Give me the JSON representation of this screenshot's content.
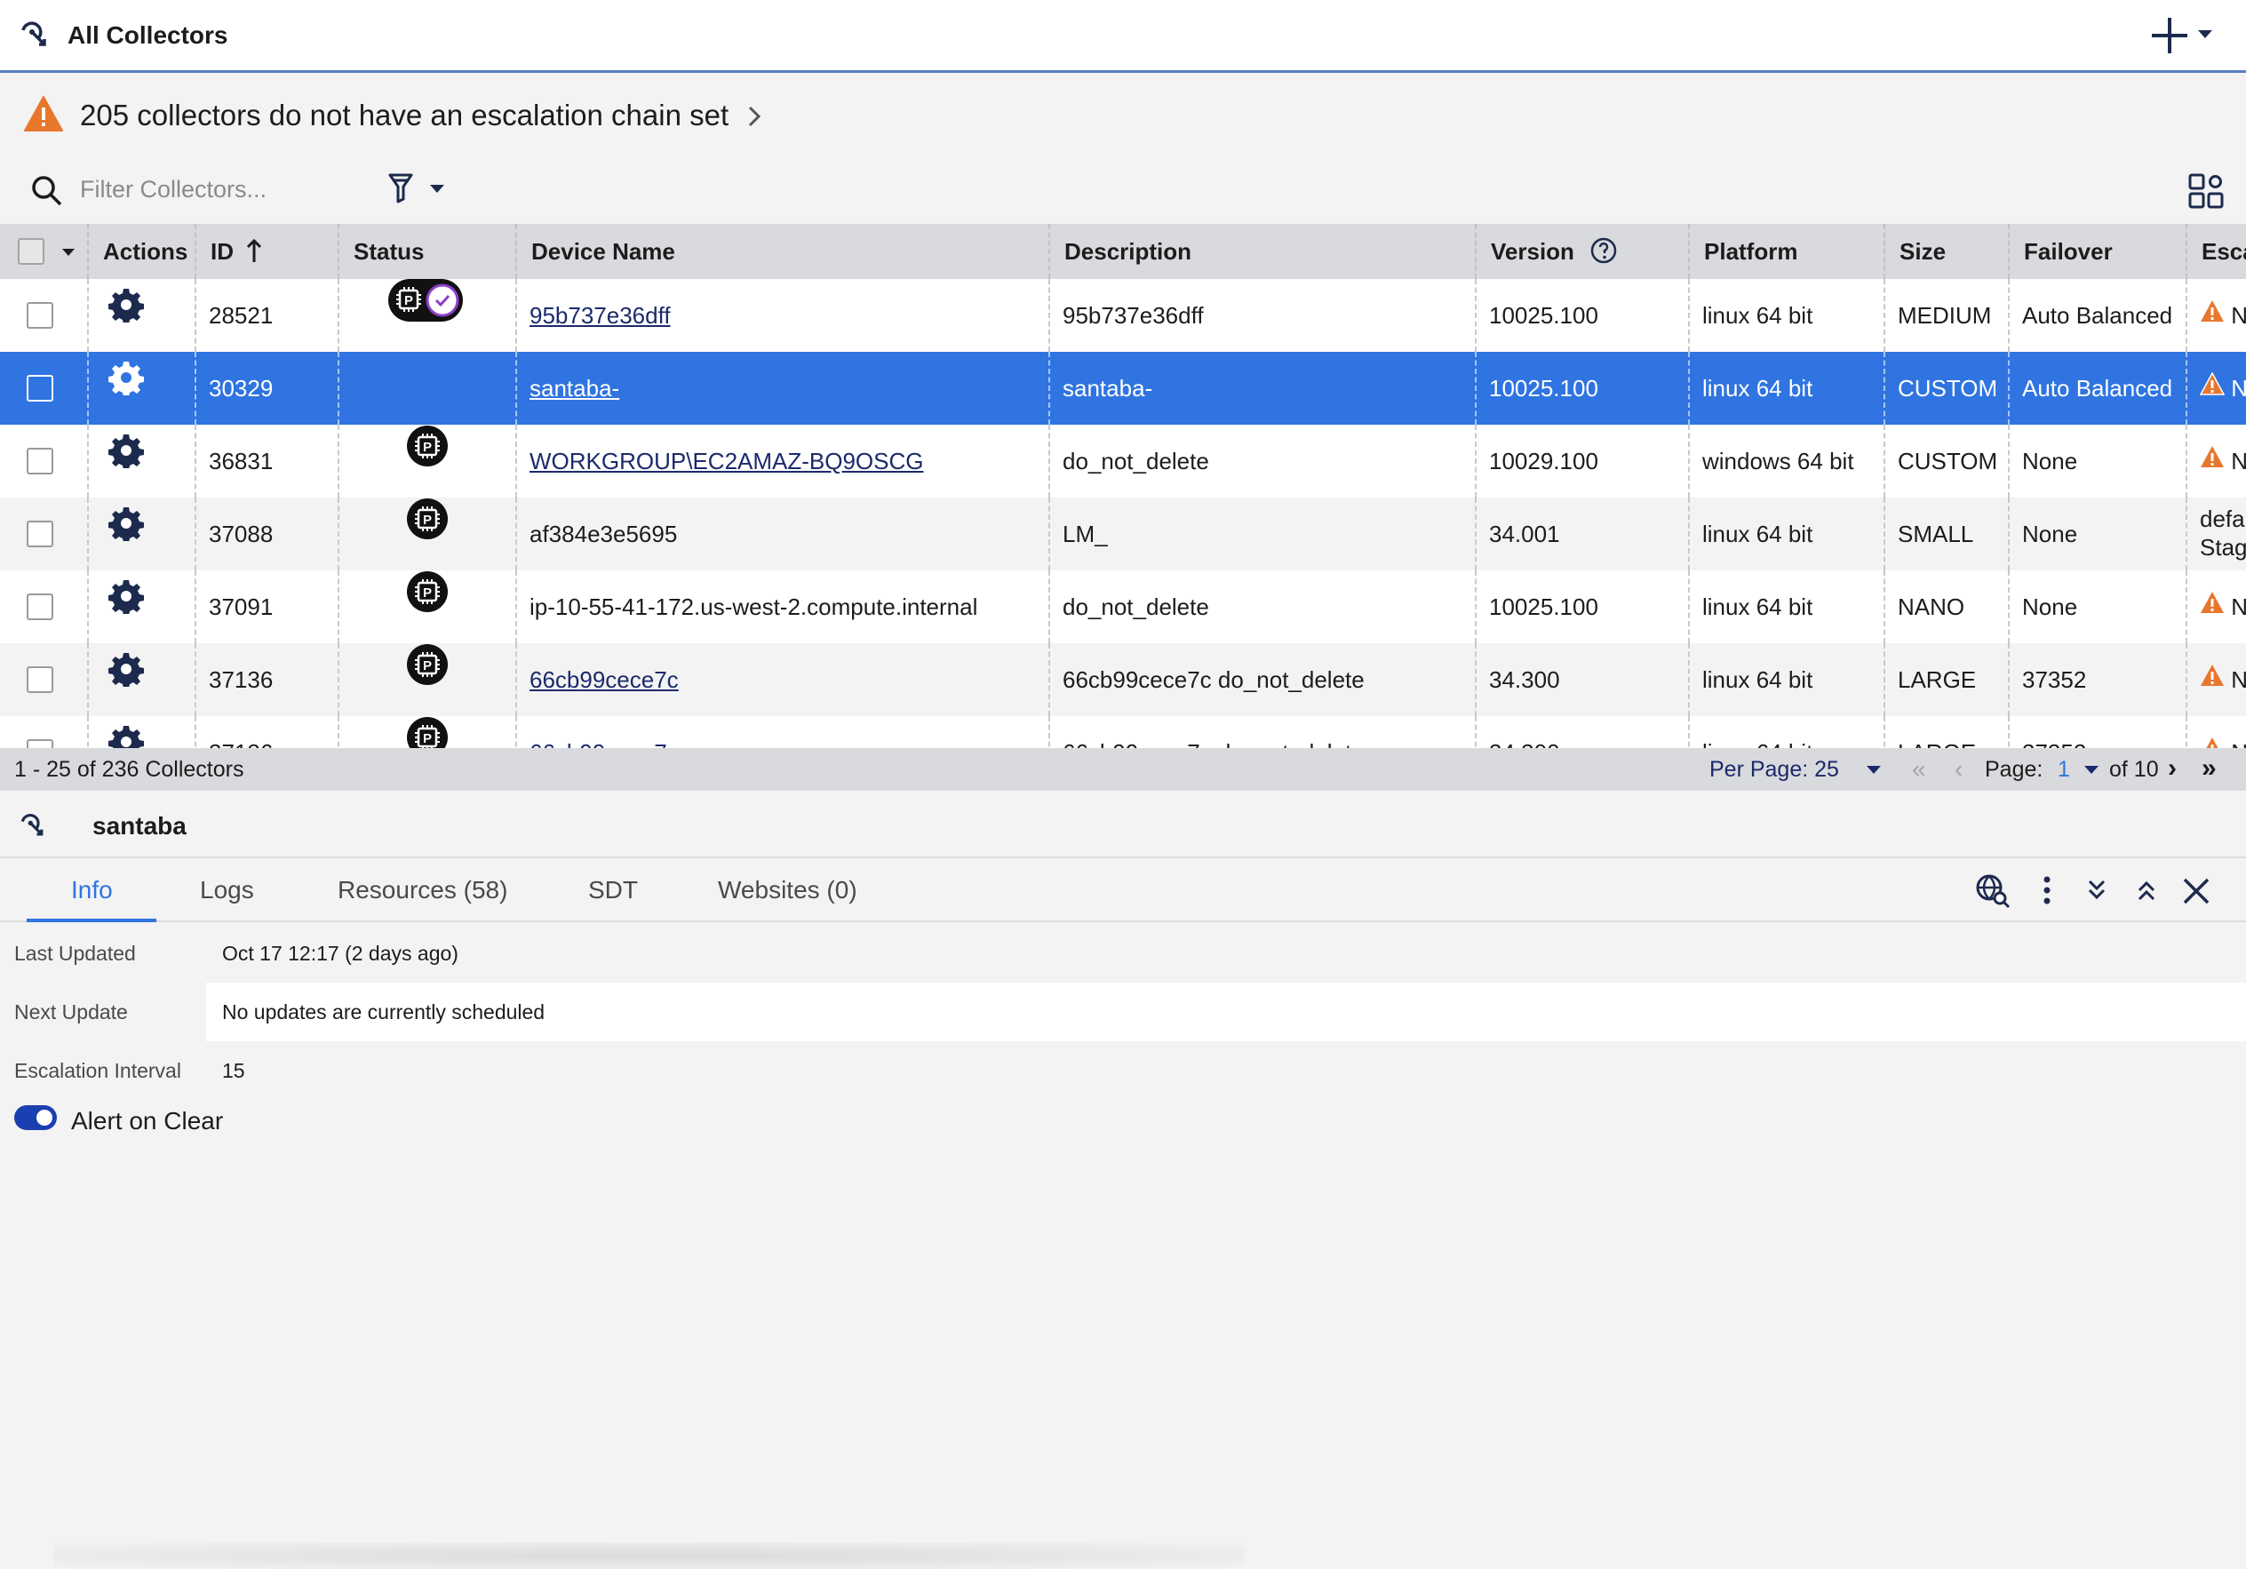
{
  "header": {
    "title": "All Collectors"
  },
  "warning": {
    "text": "205 collectors do not have an escalation chain set"
  },
  "filter": {
    "placeholder": "Filter Collectors..."
  },
  "table": {
    "columns": [
      "Actions",
      "ID",
      "Status",
      "Device Name",
      "Description",
      "Version",
      "Platform",
      "Size",
      "Failover",
      "Esca"
    ],
    "rows": [
      {
        "id": "28521",
        "status": "up-sdt",
        "device": "95b737e36dff",
        "device_link": true,
        "description": "95b737e36dff",
        "version": "10025.100",
        "platform": "linux 64 bit",
        "size": "MEDIUM",
        "failover": "Auto Balanced",
        "esc": "N",
        "esc_warn": true
      },
      {
        "id": "30329",
        "status": "",
        "device": "santaba-",
        "device_link": true,
        "description": "santaba-",
        "version": "10025.100",
        "platform": "linux 64 bit",
        "size": "CUSTOM",
        "failover": "Auto Balanced",
        "esc": "N",
        "esc_warn": true,
        "selected": true
      },
      {
        "id": "36831",
        "status": "chip",
        "device": "WORKGROUP\\EC2AMAZ-BQ9OSCG",
        "device_link": true,
        "description": "do_not_delete",
        "version": "10029.100",
        "platform": "windows 64 bit",
        "size": "CUSTOM",
        "failover": "None",
        "esc": "N",
        "esc_warn": true
      },
      {
        "id": "37088",
        "status": "chip",
        "device": "af384e3e5695",
        "device_link": false,
        "description": "LM_",
        "version": "34.001",
        "platform": "linux 64 bit",
        "size": "SMALL",
        "failover": "None",
        "esc": "defa",
        "esc2": "Stag",
        "esc_warn": false
      },
      {
        "id": "37091",
        "status": "chip",
        "device": "ip-10-55-41-172.us-west-2.compute.internal",
        "device_link": false,
        "description": "do_not_delete",
        "version": "10025.100",
        "platform": "linux 64 bit",
        "size": "NANO",
        "failover": "None",
        "esc": "N",
        "esc_warn": true
      },
      {
        "id": "37136",
        "status": "chip",
        "device": "66cb99cece7c",
        "device_link": true,
        "description": "66cb99cece7c do_not_delete",
        "version": "34.300",
        "platform": "linux 64 bit",
        "size": "LARGE",
        "failover": "37352",
        "esc": "N",
        "esc_warn": true
      }
    ]
  },
  "pager": {
    "count": "1 - 25 of 236 Collectors",
    "per_page": "Per Page: 25",
    "page_label": "Page:",
    "page": "1",
    "of": "of 10"
  },
  "detail": {
    "name": "santaba",
    "tabs": [
      "Info",
      "Logs",
      "Resources (58)",
      "SDT",
      "Websites (0)"
    ],
    "last_updated_label": "Last Updated",
    "last_updated": "Oct 17 12:17  (2 days ago)",
    "next_update_label": "Next Update",
    "next_update": "No updates are currently scheduled",
    "escalation_label": "Escalation Interval",
    "escalation": "15",
    "alert_on_clear": "Alert on Clear"
  },
  "colors": {
    "accent": "#2f74e0",
    "warning": "#e8772e",
    "navy": "#1c2a4d"
  }
}
